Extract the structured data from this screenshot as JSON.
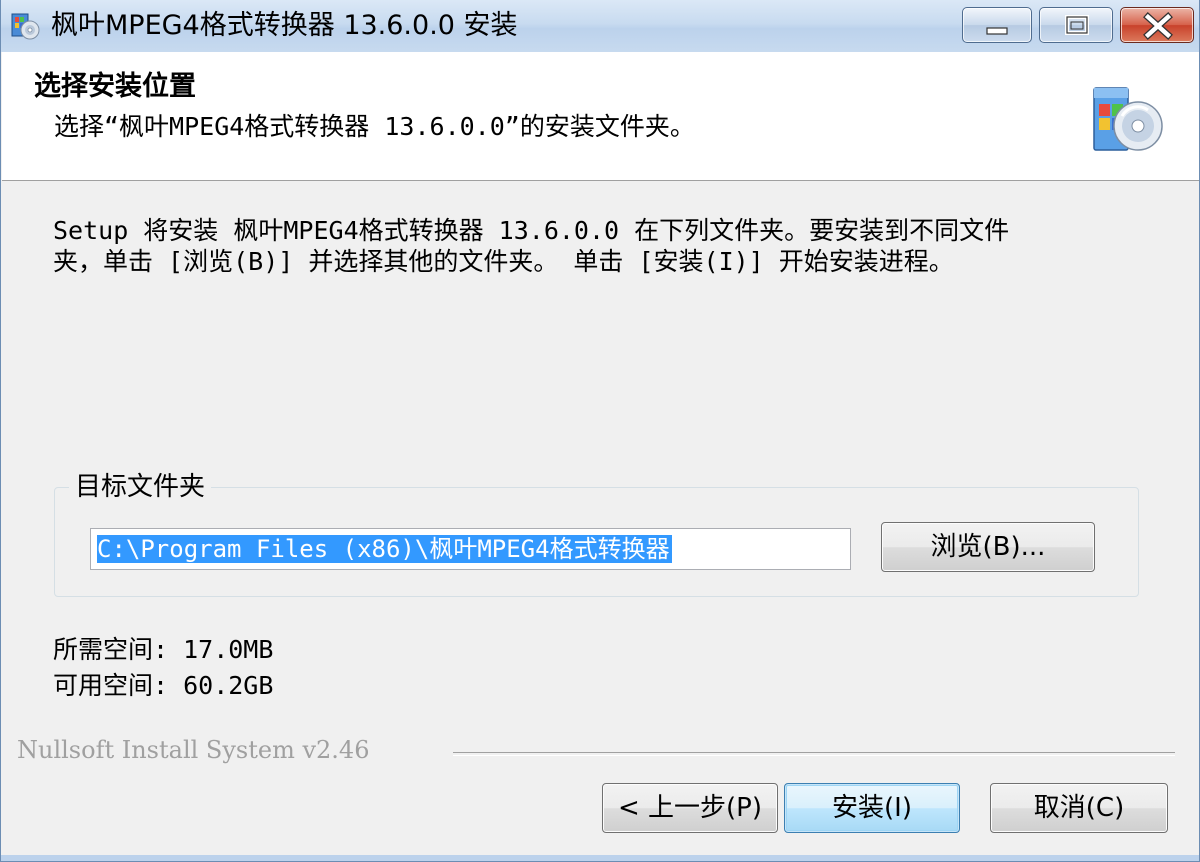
{
  "window": {
    "title": "枫叶MPEG4格式转换器 13.6.0.0 安装",
    "app_icon": "installer-cd-icon",
    "controls": {
      "minimize_icon": "minimize-icon",
      "maximize_icon": "maximize-icon",
      "close_icon": "close-icon"
    }
  },
  "header": {
    "title": "选择安装位置",
    "subtitle": "选择“枫叶MPEG4格式转换器 13.6.0.0”的安装文件夹。",
    "icon": "installer-package-icon"
  },
  "body": {
    "description_line1": "Setup 将安装 枫叶MPEG4格式转换器 13.6.0.0 在下列文件夹。要安装到不同文件",
    "description_line2": "夹，单击 [浏览(B)] 并选择其他的文件夹。 单击 [安装(I)] 开始安装进程。",
    "destination_group_label": "目标文件夹",
    "destination_path": "C:\\Program Files (x86)\\枫叶MPEG4格式转换器",
    "browse_label": "浏览(B)...",
    "space_required": "所需空间: 17.0MB",
    "space_available": "可用空间: 60.2GB"
  },
  "footer": {
    "brand": "Nullsoft Install System v2.46",
    "back_label": "< 上一步(P)",
    "install_label": "安装(I)",
    "cancel_label": "取消(C)"
  },
  "colors": {
    "selection": "#3399ff",
    "title_bar": "#c8dbf0",
    "close_button": "#c8412b",
    "window_bg": "#f0f0f0"
  }
}
